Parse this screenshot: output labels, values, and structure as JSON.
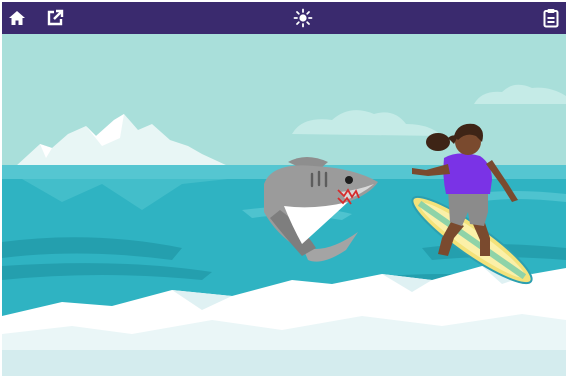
{
  "toolbar": {
    "background": "#3a2a6e",
    "icons": {
      "home": "home-icon",
      "open_new_window": "external-link-icon",
      "theme": "sun-icon",
      "clipboard": "clipboard-icon"
    }
  },
  "scene": {
    "sky_color": "#a8ddd9",
    "sea_color": "#2fb4c3",
    "foam_color": "#ffffff",
    "shirt_color": "#7a33e6",
    "board_color": "#f3e37a",
    "characters": [
      "shark",
      "surfer"
    ]
  }
}
